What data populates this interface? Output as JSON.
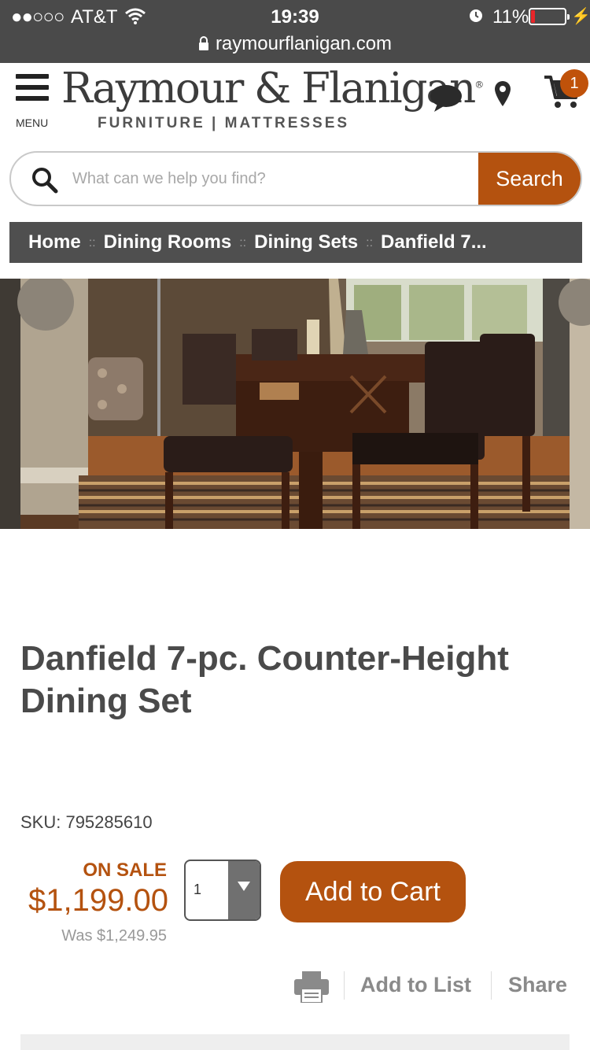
{
  "status_bar": {
    "signal": "●●○○○",
    "carrier": "AT&T",
    "time": "19:39",
    "battery_percent": "11%",
    "battery_level": 0.11,
    "battery_color": "#e8262a",
    "url": "raymourflanigan.com",
    "icons": [
      "wifi-icon",
      "alarm-icon",
      "battery-icon",
      "charging-icon",
      "lock-icon"
    ]
  },
  "header": {
    "menu_label": "MENU",
    "logo_name": "Raymour & Flanigan",
    "logo_reg": "®",
    "logo_tagline": "FURNITURE | MATTRESSES",
    "cart_count": "1",
    "icons": [
      "chat-icon",
      "location-pin-icon",
      "cart-icon"
    ]
  },
  "search": {
    "placeholder": "What can we help you find?",
    "button_label": "Search"
  },
  "breadcrumb": {
    "separator": "::",
    "items": [
      "Home",
      "Dining Rooms",
      "Dining Sets",
      "Danfield 7..."
    ]
  },
  "product": {
    "title": "Danfield 7-pc. Counter-Height Dining Set",
    "sku": "SKU: 795285610",
    "sale_label": "ON SALE",
    "price": "$1,199.00",
    "was_price": "Was $1,249.95",
    "quantity": "1",
    "add_to_cart": "Add to Cart",
    "add_to_list": "Add to List",
    "share": "Share"
  },
  "colors": {
    "brand_orange": "#b4520f",
    "status_bar": "#4a4a4a",
    "breadcrumb_bg": "#4f4f4f"
  }
}
